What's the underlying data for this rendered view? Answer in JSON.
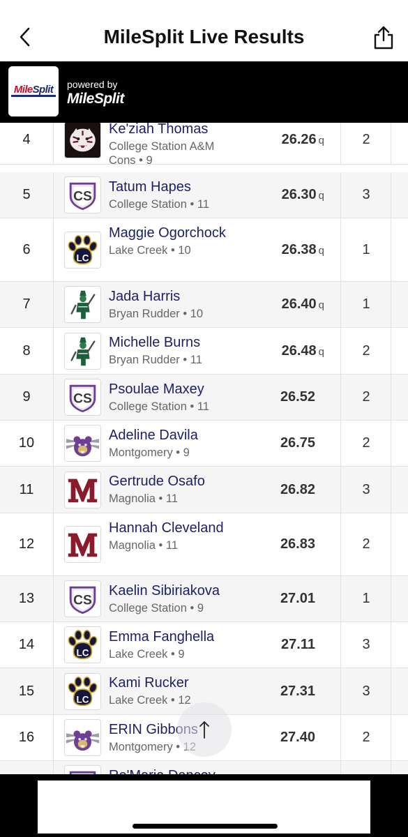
{
  "header": {
    "title": "MileSplit Live Results",
    "back_icon": "chevron-left-icon",
    "share_icon": "share-icon"
  },
  "brand": {
    "logo_text_left": "Mile",
    "logo_text_right": "Split",
    "powered_label": "powered by",
    "powered_brand": "MileSplit"
  },
  "rows": [
    {
      "place": "4",
      "athlete": "Ke'ziah Thomas",
      "school": "College Station A&M Cons • 9",
      "mark": "26.26",
      "qual": "q",
      "heat": "2",
      "logo": "tiger"
    },
    {
      "place": "5",
      "athlete": "Tatum Hapes",
      "school": "College Station • 11",
      "mark": "26.30",
      "qual": "q",
      "heat": "3",
      "logo": "cs"
    },
    {
      "place": "6",
      "athlete": "Maggie Ogorchock",
      "school": "Lake Creek • 10",
      "mark": "26.38",
      "qual": "q",
      "heat": "1",
      "logo": "paw"
    },
    {
      "place": "7",
      "athlete": "Jada Harris",
      "school": "Bryan Rudder • 10",
      "mark": "26.40",
      "qual": "q",
      "heat": "1",
      "logo": "ranger"
    },
    {
      "place": "8",
      "athlete": "Michelle Burns",
      "school": "Bryan Rudder • 11",
      "mark": "26.48",
      "qual": "q",
      "heat": "2",
      "logo": "ranger"
    },
    {
      "place": "9",
      "athlete": "Psoulae Maxey",
      "school": "College Station • 11",
      "mark": "26.52",
      "qual": "",
      "heat": "2",
      "logo": "cs"
    },
    {
      "place": "10",
      "athlete": "Adeline Davila",
      "school": "Montgomery • 9",
      "mark": "26.75",
      "qual": "",
      "heat": "2",
      "logo": "bear"
    },
    {
      "place": "11",
      "athlete": "Gertrude Osafo",
      "school": "Magnolia • 11",
      "mark": "26.82",
      "qual": "",
      "heat": "3",
      "logo": "m"
    },
    {
      "place": "12",
      "athlete": "Hannah Cleveland",
      "school": "Magnolia • 11",
      "mark": "26.83",
      "qual": "",
      "heat": "2",
      "logo": "m"
    },
    {
      "place": "13",
      "athlete": "Kaelin Sibiriakova",
      "school": "College Station • 9",
      "mark": "27.01",
      "qual": "",
      "heat": "1",
      "logo": "cs"
    },
    {
      "place": "14",
      "athlete": "Emma Fanghella",
      "school": "Lake Creek • 9",
      "mark": "27.11",
      "qual": "",
      "heat": "3",
      "logo": "paw"
    },
    {
      "place": "15",
      "athlete": "Kami Rucker",
      "school": "Lake Creek • 12",
      "mark": "27.31",
      "qual": "",
      "heat": "3",
      "logo": "paw"
    },
    {
      "place": "16",
      "athlete": "ERIN Gibbons",
      "school": "Montgomery • 12",
      "mark": "27.40",
      "qual": "",
      "heat": "2",
      "logo": "bear"
    },
    {
      "place": "",
      "athlete": "Re'Maria Dancey",
      "school": "",
      "mark": "",
      "qual": "",
      "heat": "",
      "logo": "cs"
    }
  ],
  "scroll_top_icon": "arrow-up-icon"
}
